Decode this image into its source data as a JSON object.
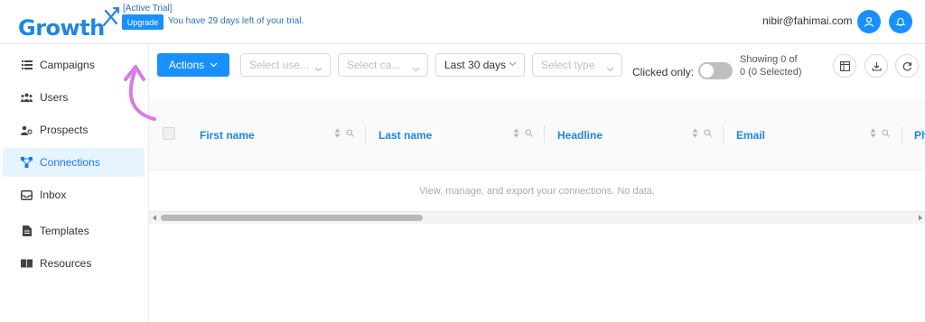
{
  "header": {
    "logo_text": "Growth",
    "trial_tag": "[Active Trial]",
    "upgrade_label": "Upgrade",
    "trial_message": "You have 29 days left of your trial.",
    "user_email": "nibir@fahimai.com",
    "icons": [
      "user-icon",
      "bell-icon"
    ]
  },
  "sidebar": {
    "items": [
      {
        "label": "Campaigns",
        "icon": "list-icon",
        "active": false
      },
      {
        "label": "Users",
        "icon": "users-icon",
        "active": false
      },
      {
        "label": "Prospects",
        "icon": "prospects-icon",
        "active": false
      },
      {
        "label": "Connections",
        "icon": "connections-icon",
        "active": true
      },
      {
        "label": "Inbox",
        "icon": "inbox-icon",
        "active": false
      },
      {
        "label": "Templates",
        "icon": "file-icon",
        "active": false
      },
      {
        "label": "Resources",
        "icon": "book-icon",
        "active": false
      }
    ]
  },
  "toolbar": {
    "actions_label": "Actions",
    "select_users_placeholder": "Select use...",
    "select_campaign_placeholder": "Select ca...",
    "date_range_value": "Last 30 days",
    "select_type_placeholder": "Select type",
    "clicked_only_label": "Clicked only:",
    "showing_text": "Showing 0 of 0 (0 Selected)"
  },
  "table": {
    "columns": [
      "First name",
      "Last name",
      "Headline",
      "Email",
      "Ph"
    ],
    "empty_message": "View, manage, and export your connections. No data."
  },
  "colors": {
    "accent": "#1890ff",
    "active_bg": "#e6f4ff",
    "decor_arrow": "#d77be6"
  }
}
